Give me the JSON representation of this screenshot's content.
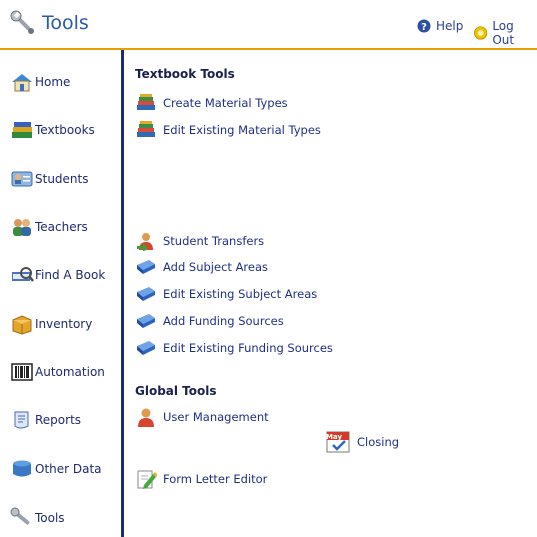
{
  "header": {
    "title": "Tools",
    "help_label": "Help",
    "logout_label": "Log Out",
    "accent_color": "#e8a000"
  },
  "sidebar": {
    "items": [
      {
        "label": "Home",
        "icon": "house-icon"
      },
      {
        "label": "Textbooks",
        "icon": "books-icon"
      },
      {
        "label": "Students",
        "icon": "student-card-icon"
      },
      {
        "label": "Teachers",
        "icon": "teachers-icon"
      },
      {
        "label": "Find A Book",
        "icon": "find-book-icon"
      },
      {
        "label": "Inventory",
        "icon": "box-icon"
      },
      {
        "label": "Automation",
        "icon": "barcode-icon"
      },
      {
        "label": "Reports",
        "icon": "report-icon"
      },
      {
        "label": "Other Data",
        "icon": "database-icon"
      },
      {
        "label": "Tools",
        "icon": "wrench-icon"
      }
    ]
  },
  "textbook_tools": {
    "title": "Textbook Tools",
    "links": [
      {
        "label": "Create Material Types",
        "icon": "book-stack-icon"
      },
      {
        "label": "Edit Existing Material Types",
        "icon": "book-stack-icon"
      },
      {
        "label": "Student Transfers",
        "icon": "user-transfer-icon"
      },
      {
        "label": "Add Subject Areas",
        "icon": "blue-book-icon"
      },
      {
        "label": "Edit Existing Subject Areas",
        "icon": "blue-book-icon"
      },
      {
        "label": "Add Funding Sources",
        "icon": "blue-book-icon"
      },
      {
        "label": "Edit Existing Funding Sources",
        "icon": "blue-book-icon"
      }
    ]
  },
  "global_tools": {
    "title": "Global Tools",
    "links": [
      {
        "label": "User Management",
        "icon": "user-icon"
      },
      {
        "label": "Closing",
        "icon": "calendar-icon",
        "calendar_text": "May"
      },
      {
        "label": "Form Letter Editor",
        "icon": "pencil-document-icon"
      }
    ]
  }
}
